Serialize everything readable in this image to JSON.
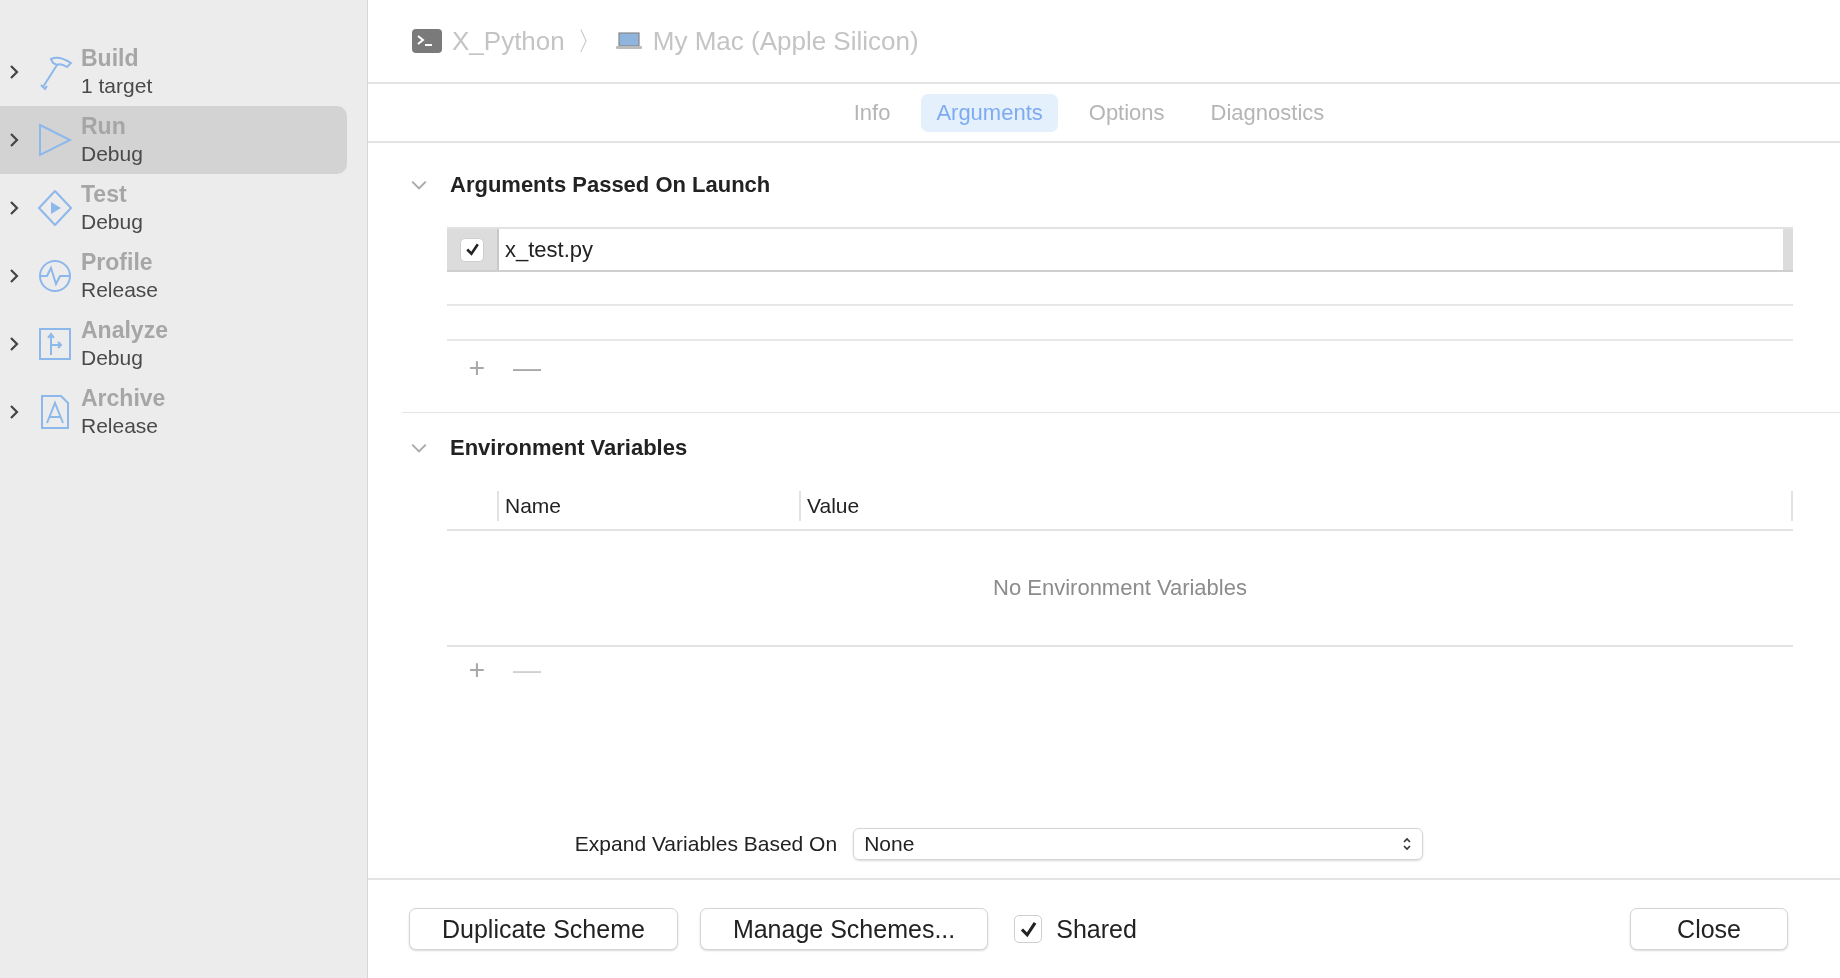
{
  "sidebar": {
    "items": [
      {
        "kind": "build",
        "title": "Build",
        "subtitle": "1 target",
        "selected": false
      },
      {
        "kind": "run",
        "title": "Run",
        "subtitle": "Debug",
        "selected": true
      },
      {
        "kind": "test",
        "title": "Test",
        "subtitle": "Debug",
        "selected": false
      },
      {
        "kind": "profile",
        "title": "Profile",
        "subtitle": "Release",
        "selected": false
      },
      {
        "kind": "analyze",
        "title": "Analyze",
        "subtitle": "Debug",
        "selected": false
      },
      {
        "kind": "archive",
        "title": "Archive",
        "subtitle": "Release",
        "selected": false
      }
    ]
  },
  "breadcrumb": {
    "scheme": "X_Python",
    "separator": "〉",
    "destination": "My Mac (Apple Silicon)"
  },
  "tabs": [
    {
      "label": "Info",
      "selected": false
    },
    {
      "label": "Arguments",
      "selected": true
    },
    {
      "label": "Options",
      "selected": false
    },
    {
      "label": "Diagnostics",
      "selected": false
    }
  ],
  "arguments_section": {
    "title": "Arguments Passed On Launch",
    "expanded": true,
    "rows": [
      {
        "checked": true,
        "value": "x_test.py"
      }
    ],
    "add": "+",
    "remove": "—"
  },
  "environment_section": {
    "title": "Environment Variables",
    "expanded": true,
    "columns": [
      "Name",
      "Value"
    ],
    "empty_text": "No Environment Variables",
    "add": "+",
    "remove": "—"
  },
  "expand_variables": {
    "label": "Expand Variables Based On",
    "value": "None"
  },
  "footer": {
    "duplicate": "Duplicate Scheme",
    "manage": "Manage Schemes...",
    "shared": {
      "label": "Shared",
      "checked": true
    },
    "close": "Close"
  }
}
